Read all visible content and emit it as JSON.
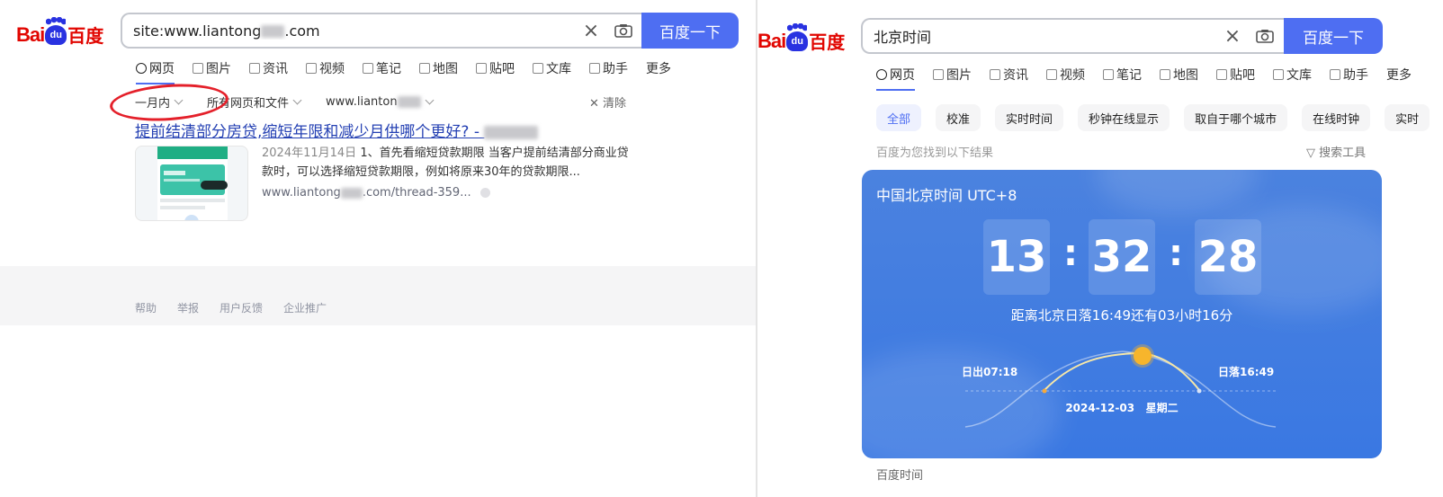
{
  "left": {
    "logo": {
      "text_a": "Bai",
      "text_b": "du",
      "text_c": "百度"
    },
    "search": {
      "query": "site:www.liantong",
      "query_suffix": ".com",
      "button": "百度一下"
    },
    "tabs": [
      {
        "label": "网页",
        "icon": "search-icon"
      },
      {
        "label": "图片",
        "icon": "image-icon"
      },
      {
        "label": "资讯",
        "icon": "news-icon"
      },
      {
        "label": "视频",
        "icon": "video-icon"
      },
      {
        "label": "笔记",
        "icon": "note-icon"
      },
      {
        "label": "地图",
        "icon": "map-icon"
      },
      {
        "label": "贴吧",
        "icon": "tieba-icon"
      },
      {
        "label": "文库",
        "icon": "doc-icon"
      },
      {
        "label": "助手",
        "icon": "ai-icon"
      },
      {
        "label": "更多",
        "icon": ""
      }
    ],
    "filters": {
      "time": "一月内",
      "type": "所有网页和文件",
      "site": "www.lianton",
      "clear": "清除"
    },
    "result": {
      "title": "提前结清部分房贷,缩短年限和减少月供哪个更好? - ",
      "date": "2024年11月14日",
      "snippet": "1、首先看缩短贷款期限 当客户提前结清部分商业贷款时，可以选择缩短贷款期限，例如将原来30年的贷款期限...",
      "url_a": "www.liantong",
      "url_b": ".com/thread-359..."
    },
    "footer": [
      "帮助",
      "举报",
      "用户反馈",
      "企业推广"
    ]
  },
  "right": {
    "logo": {
      "text_a": "Bai",
      "text_b": "du",
      "text_c": "百度"
    },
    "search": {
      "query": "北京时间",
      "button": "百度一下"
    },
    "tabs": [
      {
        "label": "网页",
        "icon": "search-icon"
      },
      {
        "label": "图片",
        "icon": "image-icon"
      },
      {
        "label": "资讯",
        "icon": "news-icon"
      },
      {
        "label": "视频",
        "icon": "video-icon"
      },
      {
        "label": "笔记",
        "icon": "note-icon"
      },
      {
        "label": "地图",
        "icon": "map-icon"
      },
      {
        "label": "贴吧",
        "icon": "tieba-icon"
      },
      {
        "label": "文库",
        "icon": "doc-icon"
      },
      {
        "label": "助手",
        "icon": "ai-icon"
      },
      {
        "label": "更多",
        "icon": ""
      }
    ],
    "chips": [
      "全部",
      "校准",
      "实时时间",
      "秒钟在线显示",
      "取自于哪个城市",
      "在线时钟",
      "实时"
    ],
    "found": "百度为您找到以下结果",
    "tools": "搜索工具",
    "card": {
      "title": "中国北京时间 UTC+8",
      "hh": "13",
      "mm": "32",
      "ss": "28",
      "sunset_note": "距离北京日落16:49还有03小时16分",
      "sunrise": "日出07:18",
      "sunset": "日落16:49",
      "date": "2024-12-03",
      "weekday": "星期二"
    },
    "source": "百度时间"
  },
  "colors": {
    "brand_blue": "#4e6ef2",
    "link": "#2440b3",
    "logo_red": "#e10601",
    "card_bg": "#3a78e2",
    "annotation_red": "#e4202a"
  }
}
